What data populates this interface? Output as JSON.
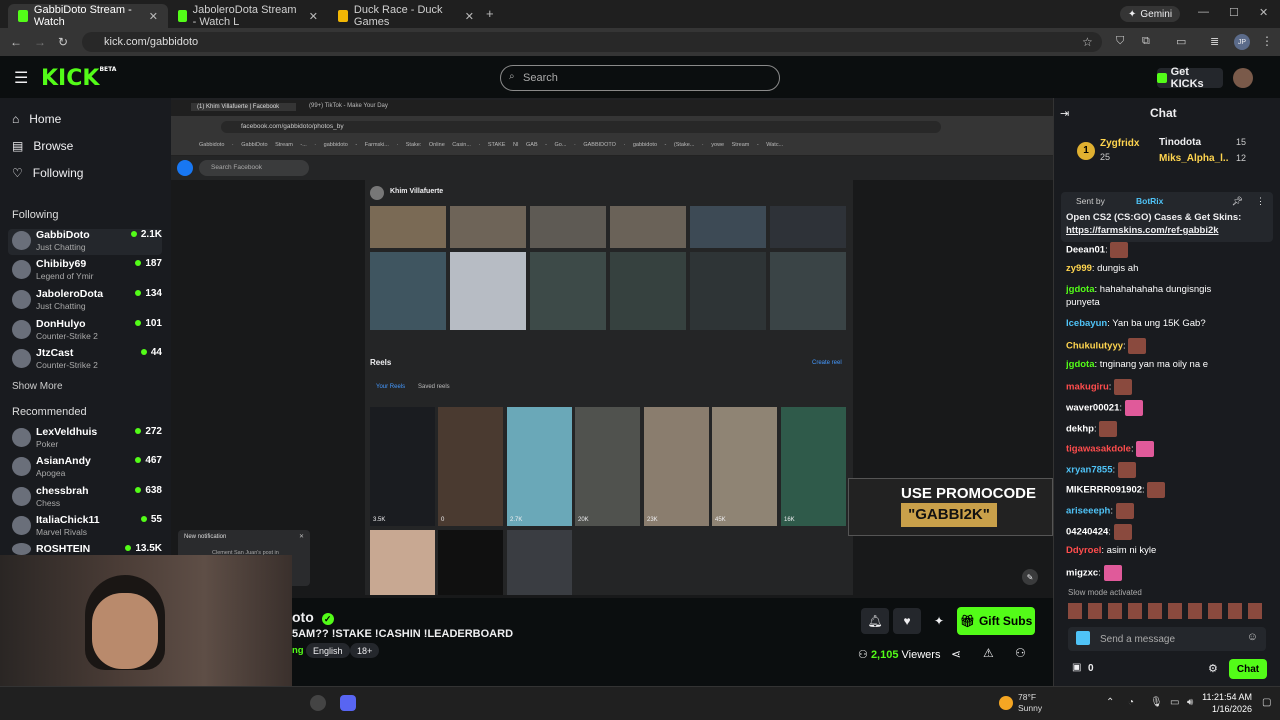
{
  "browser": {
    "tabs": [
      {
        "label": "GabbiDoto Stream - Watch",
        "active": true
      },
      {
        "label": "JaboleroDota Stream - Watch L",
        "active": false
      },
      {
        "label": "Duck Race - Duck Games",
        "active": false
      }
    ],
    "gemini": "Gemini",
    "url": "kick.com/gabbidoto",
    "profile": "JP"
  },
  "header": {
    "logo": "KICK",
    "logo_sup": "BETA",
    "search_placeholder": "Search",
    "get_kicks": "Get KICKs"
  },
  "sidebar": {
    "nav": [
      {
        "label": "Home",
        "icon": "home-icon"
      },
      {
        "label": "Browse",
        "icon": "browse-icon"
      },
      {
        "label": "Following",
        "icon": "heart-icon"
      }
    ],
    "following_header": "Following",
    "following": [
      {
        "name": "GabbiDoto",
        "game": "Just Chatting",
        "viewers": "2.1K"
      },
      {
        "name": "Chibiby69",
        "game": "Legend of Ymir",
        "viewers": "187"
      },
      {
        "name": "JaboleroDota",
        "game": "Just Chatting",
        "viewers": "134"
      },
      {
        "name": "DonHulyo",
        "game": "Counter-Strike 2",
        "viewers": "101"
      },
      {
        "name": "JtzCast",
        "game": "Counter-Strike 2",
        "viewers": "44"
      }
    ],
    "show_more": "Show More",
    "recommended_header": "Recommended",
    "recommended": [
      {
        "name": "LexVeldhuis",
        "game": "Poker",
        "viewers": "272"
      },
      {
        "name": "AsianAndy",
        "game": "Apogea",
        "viewers": "467"
      },
      {
        "name": "chessbrah",
        "game": "Chess",
        "viewers": "638"
      },
      {
        "name": "ItaliaChick11",
        "game": "Marvel Rivals",
        "viewers": "55"
      },
      {
        "name": "ROSHTEIN",
        "game": "",
        "viewers": "13.5K"
      }
    ]
  },
  "stream_view": {
    "inner_tabs": [
      "(1) Khim Villafuerte | Facebook",
      "(99+) TikTok - Make Your Day"
    ],
    "inner_url": "facebook.com/gabbidoto/photos_by",
    "bookmarks": [
      "YouTube",
      "X",
      "Facebook",
      "Gabbidoto",
      "GabbiDoto Stream -...",
      "gabbidoto - Farmski...",
      "Stake: Online Casin...",
      "STAKE NI GAB - Go...",
      "GABBIDOTO",
      "gabbidoto - (Stake...",
      "yowe Stream - Watc..."
    ],
    "fb_search": "Search Facebook",
    "profile_name": "Khim Villafuerte",
    "reels_label": "Reels",
    "create_reel": "Create reel",
    "your_reels": "Your Reels",
    "saved_reels": "Saved reels",
    "reel_views": [
      "3.5K",
      "0",
      "2.7K",
      "20K",
      "23K",
      "45K",
      "16K"
    ],
    "promo_line1": "USE PROMOCODE",
    "promo_line2": "\"GABBI2K\"",
    "notif_title": "New notification",
    "notif_text": "Clement San Juan's post in"
  },
  "stream_info": {
    "streamer_partial": "oto",
    "title": "5AM?? !STAKE !CASHIN !LEADERBOARD",
    "category_partial": "ng",
    "language": "English",
    "age": "18+",
    "gift_subs": "Gift Subs",
    "viewers_count": "2,105",
    "viewers_label": "Viewers"
  },
  "chat": {
    "title": "Chat",
    "gifters": [
      {
        "name": "Zygfridx",
        "count": "25"
      },
      {
        "name": "Tinodota",
        "count": "15"
      },
      {
        "name": "Miks_Alpha_l...",
        "count": "12"
      }
    ],
    "pinned_sender": "Sent by",
    "pinned_user": "BotRix",
    "pinned_text": "Open CS2 (CS:GO) Cases & Get Skins:",
    "pinned_link": "https://farmskins.com/ref-gabbi2k",
    "messages": [
      {
        "user": "Deean01",
        "text": "",
        "color": "#e3e3e3"
      },
      {
        "user": "zy999",
        "text": "dungis ah",
        "color": "#ffd54f"
      },
      {
        "user": "jgdota",
        "text": "hahahahahaha dungisngis",
        "color": "#53fc18"
      },
      {
        "user": "",
        "text": "punyeta",
        "color": "#fff"
      },
      {
        "user": "Icebayun",
        "text": "Yan ba ung 15K Gab?",
        "color": "#4fc3f7"
      },
      {
        "user": "Chukulutyyy",
        "text": "",
        "color": "#ffd54f"
      },
      {
        "user": "jgdota",
        "text": "tnginang yan ma oily na e",
        "color": "#53fc18"
      },
      {
        "user": "makugiru",
        "text": "",
        "color": "#ff4d4d"
      },
      {
        "user": "waver00021",
        "text": "",
        "color": "#fff"
      },
      {
        "user": "dekhp",
        "text": "",
        "color": "#fff"
      },
      {
        "user": "tigawasakdole",
        "text": "",
        "color": "#ff4d4d"
      },
      {
        "user": "xryan7855",
        "text": "",
        "color": "#4fc3f7"
      },
      {
        "user": "MIKERRR091902",
        "text": "",
        "color": "#fff"
      },
      {
        "user": "ariseeeph",
        "text": "",
        "color": "#4fc3f7"
      },
      {
        "user": "04240424",
        "text": "",
        "color": "#fff"
      },
      {
        "user": "Ddyroel",
        "text": "asim ni kyle",
        "color": "#ff4d4d"
      },
      {
        "user": "migzxc",
        "text": "",
        "color": "#fff"
      }
    ],
    "slow_mode": "Slow mode activated",
    "input_placeholder": "Send a message",
    "points": "0",
    "chat_button": "Chat"
  },
  "taskbar": {
    "weather_temp": "78°F",
    "weather_cond": "Sunny",
    "time": "11:21:54 AM",
    "date": "1/16/2026"
  },
  "colors": {
    "kick_green": "#53fc18",
    "bg": "#0b0e0f",
    "panel": "#191b1f"
  }
}
